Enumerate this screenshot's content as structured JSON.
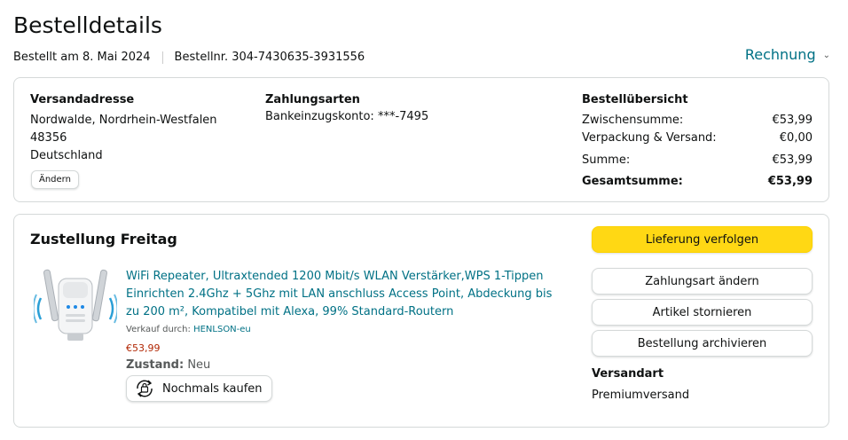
{
  "header": {
    "title": "Bestelldetails",
    "ordered_on": "Bestellt am 8. Mai 2024",
    "order_number": "Bestellnr. 304-7430635-3931556",
    "invoice_label": "Rechnung"
  },
  "summary": {
    "shipping": {
      "title": "Versandadresse",
      "lines": [
        "Nordwalde, Nordrhein-Westfalen",
        "48356",
        "Deutschland"
      ],
      "change_label": "Ändern"
    },
    "payment": {
      "title": "Zahlungsarten",
      "method": "Bankeinzugskonto: ***-7495"
    },
    "overview": {
      "title": "Bestellübersicht",
      "rows": [
        {
          "label": "Zwischensumme:",
          "value": "€53,99"
        },
        {
          "label": "Verpackung & Versand:",
          "value": "€0,00"
        },
        {
          "label": "Summe:",
          "value": "€53,99"
        },
        {
          "label": "Gesamtsumme:",
          "value": "€53,99"
        }
      ]
    }
  },
  "delivery": {
    "title": "Zustellung Freitag",
    "product": {
      "title": "WiFi Repeater, Ultraxtended 1200 Mbit/s WLAN Verstärker,WPS 1-Tippen Einrichten 2.4Ghz + 5Ghz mit LAN anschluss Access Point, Abdeckung bis zu 200 m², Kompatibel mit Alexa, 99% Standard-Routern",
      "seller_prefix": "Verkauf durch:",
      "seller_name": "HENLSON-eu",
      "price": "€53,99",
      "condition_label": "Zustand:",
      "condition_value": "Neu",
      "rebuy_label": "Nochmals kaufen"
    },
    "actions": {
      "track": "Lieferung verfolgen",
      "change_payment": "Zahlungsart ändern",
      "cancel": "Artikel stornieren",
      "archive": "Bestellung archivieren"
    },
    "shipping_method": {
      "title": "Versandart",
      "value": "Premiumversand"
    }
  },
  "colors": {
    "link": "#007185",
    "primary_button": "#ffd814",
    "price": "#b12704",
    "border": "#d5d9d9"
  }
}
